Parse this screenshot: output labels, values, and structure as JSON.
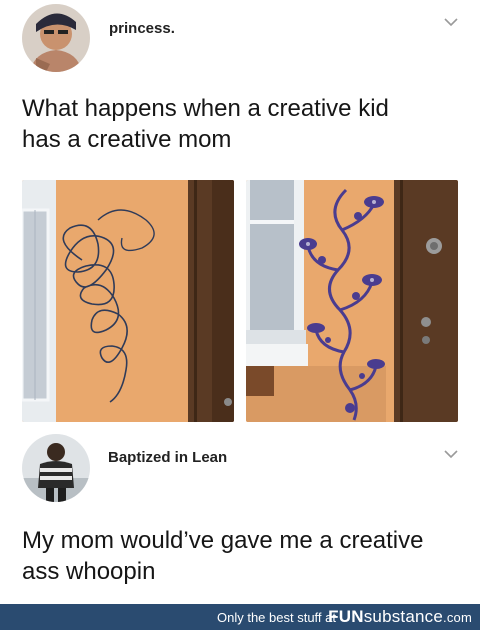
{
  "post": {
    "author": "princess.",
    "text_line_1": "What happens when a creative kid",
    "text_line_2": "has a creative mom",
    "images": [
      {
        "name": "scribbled-wall-photo"
      },
      {
        "name": "painted-wall-photo"
      }
    ]
  },
  "comment": {
    "author": "Baptized in Lean",
    "text_line_1": "My mom would’ve gave me a creative",
    "text_line_2": "ass whoopin"
  },
  "footer": {
    "tagline": "Only the best stuff at",
    "brand_prefix": "FUN",
    "brand_suffix": "substance",
    "brand_domain": ".com",
    "background": "#2a4b70"
  },
  "colors": {
    "wall": "#e9a86d",
    "door": "#5a3a24",
    "ornament": "#4a3c8f"
  }
}
